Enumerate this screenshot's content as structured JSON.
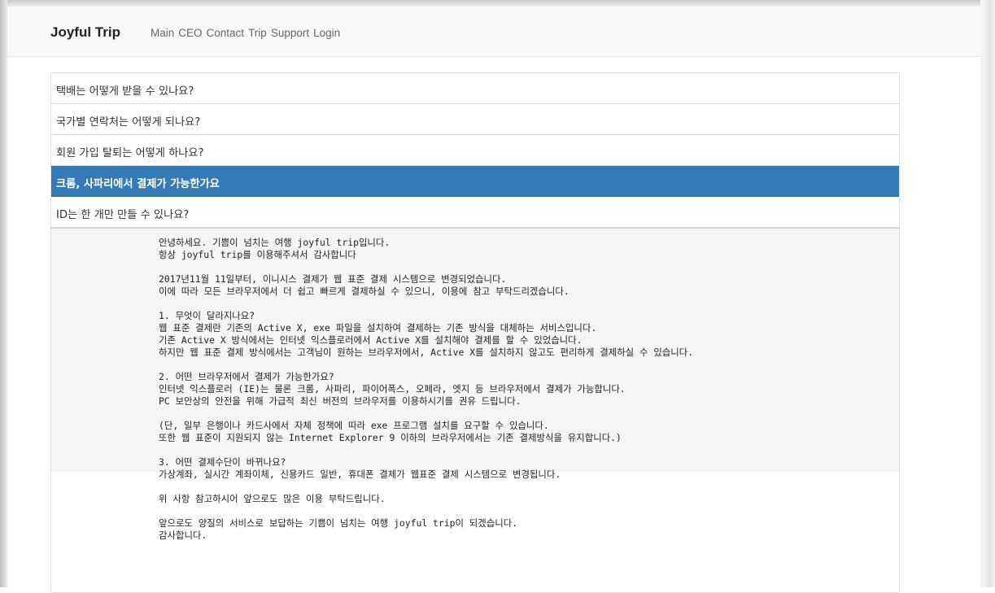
{
  "navbar": {
    "brand": "Joyful Trip",
    "links": [
      "Main",
      "CEO",
      "Contact",
      "Trip",
      "Support",
      "Login"
    ]
  },
  "faq": {
    "questions": [
      "택배는 어떻게 받을 수 있나요?",
      "국가별 연락처는 어떻게 되나요?",
      "회원 가입 탈퇴는 어떻게 하나요?",
      "크롬, 사파리에서 결제가 가능한가요",
      "ID는 한 개만 만들 수 있나요?"
    ],
    "active_index": 3,
    "answer_text": "안녕하세요. 기쁨이 넘치는 여행 joyful trip입니다.\n항상 joyful trip를 이용해주셔서 감사합니다\n\n2017년11월 11일부터, 이니시스 결제가 웹 표준 결제 시스템으로 변경되었습니다.\n이에 따라 모든 브라우저에서 더 쉽고 빠르게 결제하실 수 있으니, 이용에 참고 부탁드리겠습니다.\n\n1. 무엇이 달라지나요?\n웹 표준 결제란 기존의 Active X, exe 파일을 설치하여 결제하는 기존 방식을 대체하는 서비스입니다.\n기존 Active X 방식에서는 인터넷 익스플로러에서 Active X를 설치해야 결제를 할 수 있었습니다.\n하지만 웹 표준 결제 방식에서는 고객님이 원하는 브라우저에서, Active X를 설치하지 않고도 편리하게 결제하실 수 있습니다.\n\n2. 어떤 브라우저에서 결제가 가능한가요?\n인터넷 익스플로러 (IE)는 물론 크롬, 사파리, 파이어폭스, 오페라, 엣지 등 브라우저에서 결제가 가능합니다.\nPC 보안상의 안전을 위해 가급적 최신 버전의 브라우저를 이용하시기를 권유 드립니다.\n\n(단, 일부 은행이나 카드사에서 자체 정책에 따라 exe 프로그램 설치를 요구할 수 있습니다.\n또한 웹 표준이 지원되지 않는 Internet Explorer 9 이하의 브라우저에서는 기존 결제방식을 유지합니다.)\n\n3. 어떤 결제수단이 바뀌나요?\n가상계좌, 실시간 계좌이체, 신용카드 일반, 휴대폰 결제가 웹표준 결제 시스템으로 변경됩니다.\n\n위 사항 참고하시어 앞으로도 많은 이용 부탁드립니다.\n\n앞으로도 양질의 서비스로 보답하는 기쁨이 넘치는 여행 joyful trip이 되겠습니다.\n감사합니다."
  },
  "colors": {
    "active_bg": "#337ab7",
    "navbar_bg": "#f8f8f8",
    "answer_bg": "#f5f5f5"
  }
}
